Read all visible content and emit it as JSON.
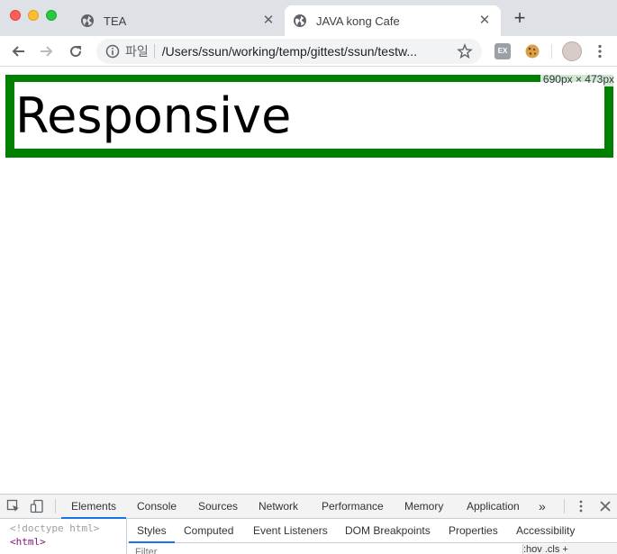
{
  "browser": {
    "tabs": [
      {
        "title": "TEA",
        "active": false
      },
      {
        "title": "JAVA kong Cafe",
        "active": true
      }
    ],
    "omnibox": {
      "scheme_label": "파일",
      "url": "/Users/ssun/working/temp/gittest/ssun/testw..."
    }
  },
  "page": {
    "heading": "Responsive",
    "viewport_size_label": "690px × 473px",
    "box_border_color": "#008000"
  },
  "devtools": {
    "main_tabs": [
      "Elements",
      "Console",
      "Sources",
      "Network",
      "Performance",
      "Memory",
      "Application"
    ],
    "more_label": "»",
    "dom_lines": [
      "<!doctype html>",
      "<html>"
    ],
    "styles_tabs": [
      "Styles",
      "Computed",
      "Event Listeners",
      "DOM Breakpoints",
      "Properties",
      "Accessibility"
    ],
    "filter_placeholder": "Filter",
    "filter_buttons_label": ":hov .cls +"
  }
}
